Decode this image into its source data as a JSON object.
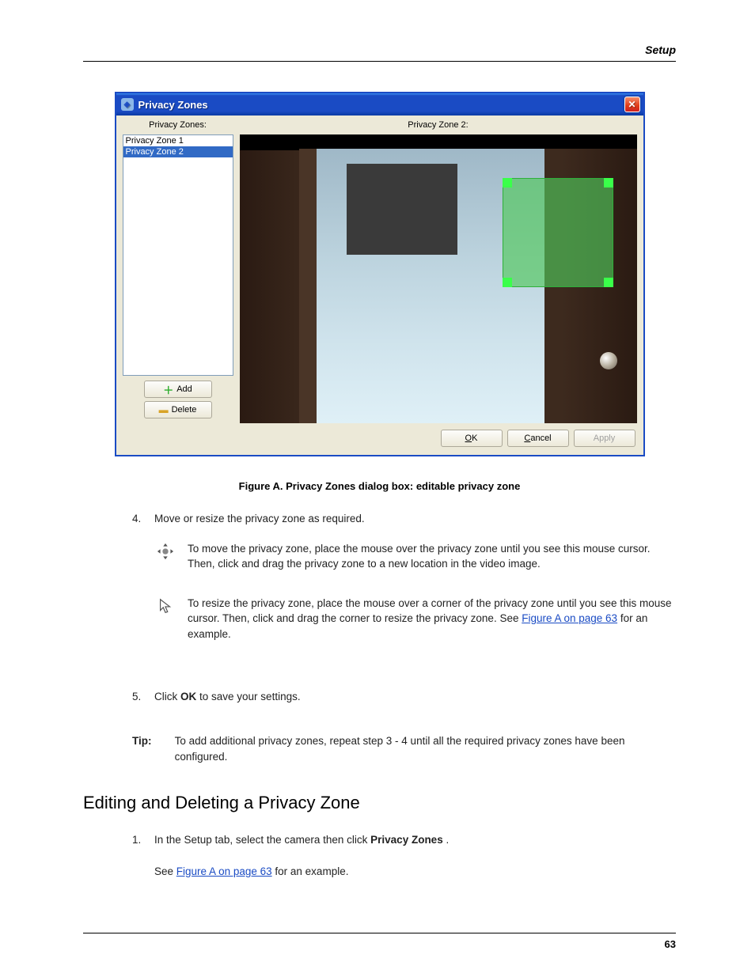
{
  "header": {
    "section": "Setup"
  },
  "window": {
    "title": "Privacy Zones",
    "left_label": "Privacy Zones:",
    "right_label": "Privacy Zone 2:",
    "list_items": [
      "Privacy Zone 1",
      "Privacy Zone 2"
    ],
    "selected_index": 1,
    "add_label": "Add",
    "delete_label": "Delete",
    "ok_label": "OK",
    "cancel_label": "Cancel",
    "apply_label": "Apply"
  },
  "figure_caption": "Figure A.   Privacy Zones dialog box: editable privacy zone",
  "steps": {
    "num_4": "4.",
    "step4_intro": "Move or resize the privacy zone as required.",
    "bullet_move": "To move the privacy zone, place the mouse over the privacy zone until you see this mouse cursor. Then, click and drag the privacy zone to a new location in the video image.",
    "bullet_resize_prefix": "To resize the privacy zone, place the mouse over a corner of the privacy zone until you see this mouse cursor. Then, click and drag the corner to resize the privacy zone. See ",
    "bullet_resize_suffix": " for an example.",
    "link_figure": "Figure A on page 63",
    "num_5": "5.",
    "step5_text_prefix": "Click ",
    "step5_ok": "OK",
    "step5_text_suffix": " to save your settings."
  },
  "tip": {
    "label": "Tip:",
    "text": "To add additional privacy zones, repeat step 3 - 4 until all the required privacy zones have been configured."
  },
  "heading2": "Editing and Deleting a Privacy Zone",
  "edit_steps": {
    "num_1": "1.",
    "text_prefix": "In the Setup tab, select the camera then click ",
    "bold": "Privacy Zones",
    "text_suffix": "."
  },
  "see": {
    "prefix": "See ",
    "link": "Figure A on page 63",
    "suffix": " for an example."
  },
  "page_number": "63"
}
